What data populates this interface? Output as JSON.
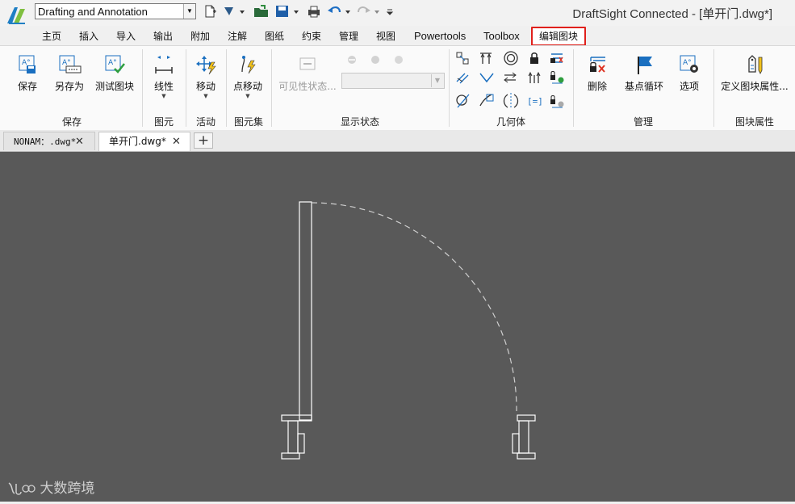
{
  "titlebar": {
    "workspace_value": "Drafting and Annotation",
    "window_title": "DraftSight Connected - [单开门.dwg*]"
  },
  "menu": {
    "tabs": [
      "主页",
      "插入",
      "导入",
      "输出",
      "附加",
      "注解",
      "图纸",
      "约束",
      "管理",
      "视图",
      "Powertools",
      "Toolbox",
      "编辑图块"
    ],
    "active_tab": "编辑图块",
    "active_color": "#e0211c"
  },
  "ribbon": {
    "save_group": {
      "label": "保存",
      "buttons": [
        "保存",
        "另存为",
        "测试图块"
      ]
    },
    "entity_group": {
      "label": "图元",
      "buttons": [
        "线性"
      ]
    },
    "action_group": {
      "label": "活动",
      "buttons": [
        "移动"
      ]
    },
    "entity_set_group": {
      "label": "图元集",
      "buttons": [
        "点移动"
      ]
    },
    "visibility_group": {
      "label": "显示状态",
      "buttons": [
        "可见性状态..."
      ]
    },
    "geometry_group": {
      "label": "几何体"
    },
    "manage_group": {
      "label": "管理",
      "buttons": [
        "删除",
        "基点循环",
        "选项"
      ]
    },
    "block_attr_group": {
      "label": "图块属性",
      "buttons": [
        "定义图块属性..."
      ]
    }
  },
  "doc_tabs": {
    "tabs": [
      "NONAM：.dwg*",
      "单开门.dwg*"
    ],
    "active": "单开门.dwg*"
  },
  "watermark": {
    "text": "大数跨境"
  },
  "colors": {
    "canvas": "#595959",
    "drawing_lines": "#ffffff",
    "accent_blue": "#1a6fc0"
  }
}
